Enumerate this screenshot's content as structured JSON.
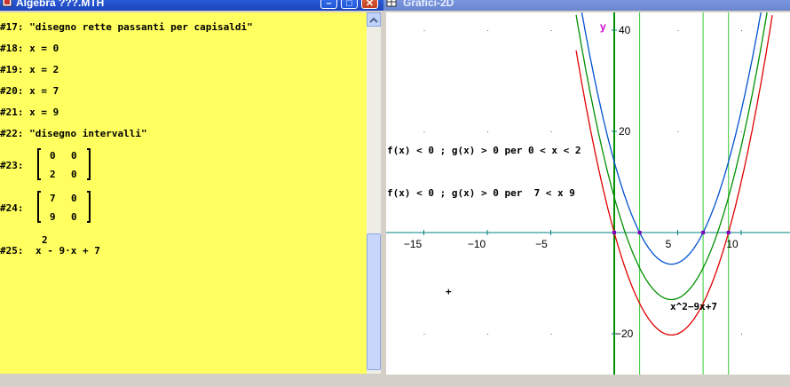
{
  "left_window": {
    "title": "Algebra  ???.MTH",
    "buttons": {
      "minimize": "–",
      "maximize": "□",
      "close": "✕"
    },
    "lines": [
      {
        "label": "#17:",
        "text": "\"disegno rette passanti per capisaldi\""
      },
      {
        "label": "#18:",
        "text": "x = 0"
      },
      {
        "label": "#19:",
        "text": "x = 2"
      },
      {
        "label": "#20:",
        "text": "x = 7"
      },
      {
        "label": "#21:",
        "text": "x = 9"
      },
      {
        "label": "#22:",
        "text": "\"disegno intervalli\""
      }
    ],
    "matrices": [
      {
        "label": "#23:",
        "rows": [
          [
            "0",
            "0"
          ],
          [
            "2",
            "0"
          ]
        ]
      },
      {
        "label": "#24:",
        "rows": [
          [
            "7",
            "0"
          ],
          [
            "9",
            "0"
          ]
        ]
      }
    ],
    "expression": {
      "label": "#25:",
      "base": "x",
      "exponent": "2",
      "rest": "- 9·x + 7"
    }
  },
  "right_window": {
    "title": "Grafici-2D",
    "axis": {
      "y_label": "y",
      "x_ticks": [
        "−15",
        "−10",
        "−5",
        "5",
        "10"
      ],
      "y_ticks": [
        "40",
        "20",
        "−20"
      ]
    },
    "annotations": {
      "interval1": "f(x) < 0 ; g(x) > 0 per 0 < x < 2",
      "interval2": "f(x) < 0 ; g(x) > 0 per  7 < x 9",
      "curve_label": "x^2−9x+7",
      "cursor_marker": "+"
    },
    "colors": {
      "red": "#e00000",
      "green": "#009000",
      "blue": "#0050d0",
      "vline": "#00c000",
      "axis_teal": "#008080"
    }
  }
}
